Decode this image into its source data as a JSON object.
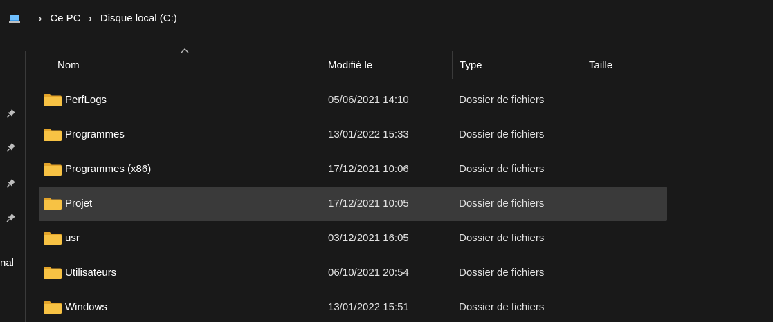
{
  "breadcrumb": {
    "items": [
      "Ce PC",
      "Disque local (C:)"
    ],
    "separator": "›"
  },
  "nav_pane": {
    "partial_label": "nal",
    "pins": [
      "pin-icon",
      "pin-icon",
      "pin-icon",
      "pin-icon"
    ]
  },
  "columns": {
    "name": "Nom",
    "modified": "Modifié le",
    "type": "Type",
    "size": "Taille",
    "sorted_by": "name",
    "sort_direction": "ascending"
  },
  "files": [
    {
      "name": "PerfLogs",
      "modified": "05/06/2021 14:10",
      "type": "Dossier de fichiers",
      "size": "",
      "selected": false
    },
    {
      "name": "Programmes",
      "modified": "13/01/2022 15:33",
      "type": "Dossier de fichiers",
      "size": "",
      "selected": false
    },
    {
      "name": "Programmes (x86)",
      "modified": "17/12/2021 10:06",
      "type": "Dossier de fichiers",
      "size": "",
      "selected": false
    },
    {
      "name": "Projet",
      "modified": "17/12/2021 10:05",
      "type": "Dossier de fichiers",
      "size": "",
      "selected": true
    },
    {
      "name": "usr",
      "modified": "03/12/2021 16:05",
      "type": "Dossier de fichiers",
      "size": "",
      "selected": false
    },
    {
      "name": "Utilisateurs",
      "modified": "06/10/2021 20:54",
      "type": "Dossier de fichiers",
      "size": "",
      "selected": false
    },
    {
      "name": "Windows",
      "modified": "13/01/2022 15:51",
      "type": "Dossier de fichiers",
      "size": "",
      "selected": false
    }
  ],
  "colors": {
    "background": "#191919",
    "selection": "#3a3a3a",
    "folder": "#f7c244",
    "folder_tab": "#e3a42a",
    "text": "#ffffff",
    "secondary_text": "#e2e2e2",
    "divider": "#3a3a3a"
  }
}
